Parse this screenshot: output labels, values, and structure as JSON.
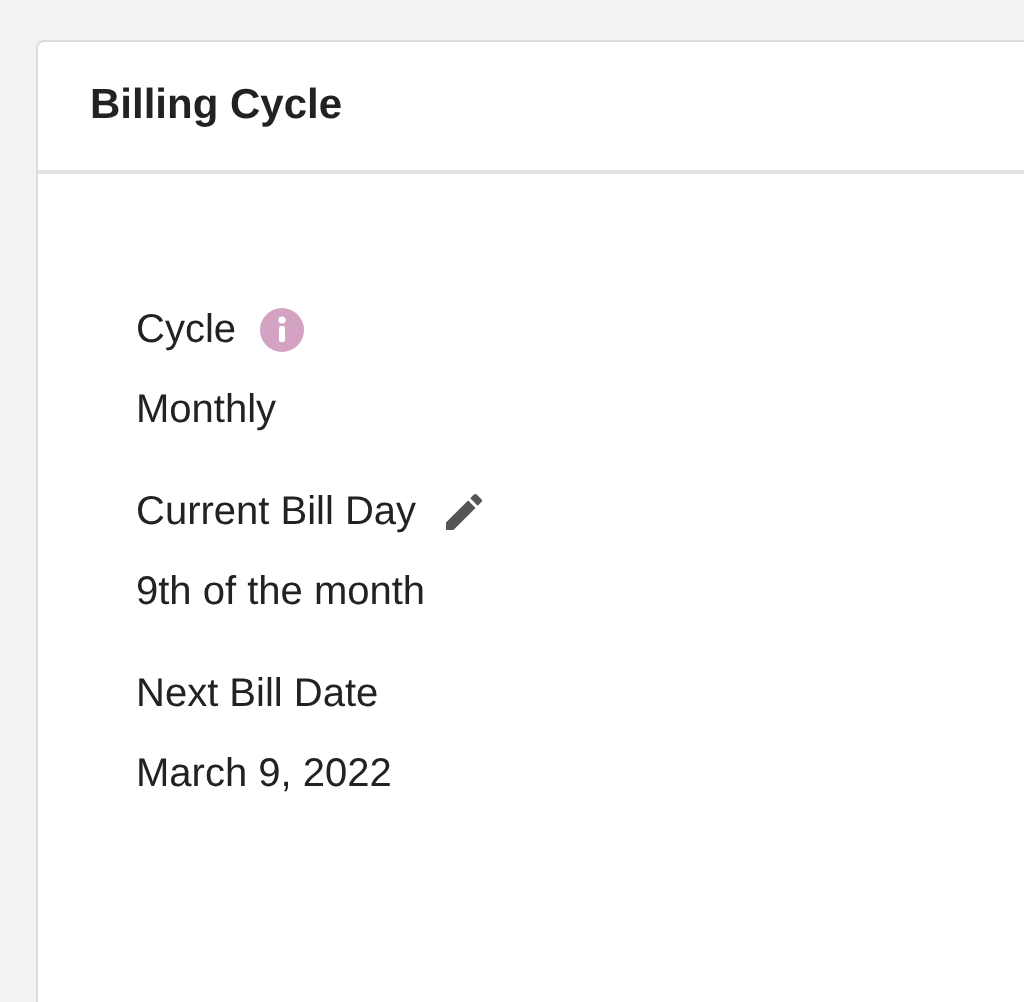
{
  "card": {
    "title": "Billing Cycle"
  },
  "fields": [
    {
      "label": "Cycle",
      "value": "Monthly",
      "kind": "info"
    },
    {
      "label": "Current Bill Day",
      "value": "9th of the month",
      "kind": "edit"
    },
    {
      "label": "Next Bill Date",
      "value": "March 9, 2022",
      "kind": "plain"
    }
  ]
}
